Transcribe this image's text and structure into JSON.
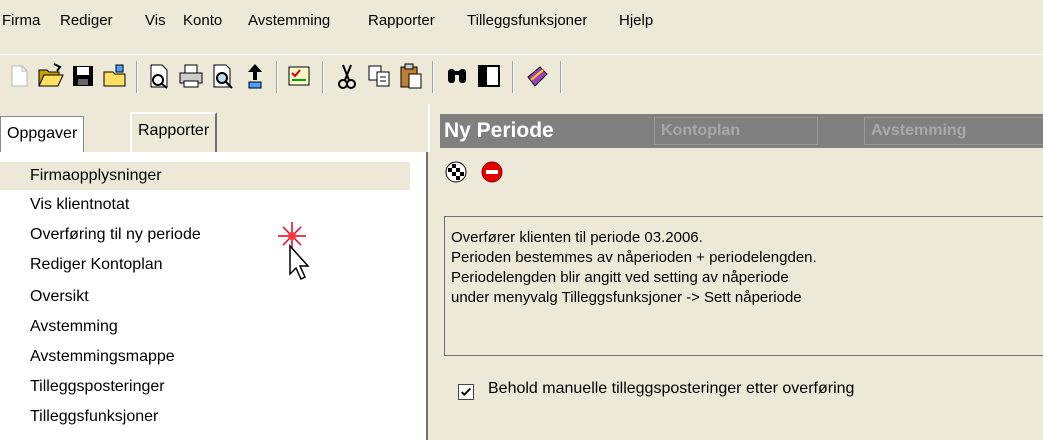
{
  "menu": [
    "Firma",
    "Rediger",
    "Vis",
    "Konto",
    "Avstemming",
    "Rapporter",
    "Tilleggsfunksjoner",
    "Hjelp"
  ],
  "toolbar": {
    "icons": [
      "new-document-icon",
      "open-folder-icon",
      "save-icon",
      "close-folder-icon",
      "preview-document-icon",
      "print-icon",
      "print-preview-icon",
      "export-icon",
      "checklist-icon",
      "cut-icon",
      "copy-icon",
      "paste-icon",
      "find-icon",
      "panel-icon",
      "help-book-icon"
    ]
  },
  "left_tabs": {
    "tasks": "Oppgaver",
    "reports": "Rapporter"
  },
  "tasks": [
    "Firmaopplysninger",
    "Vis klientnotat",
    "Overføring til ny periode",
    "Rediger Kontoplan",
    "Oversikt",
    "Avstemming",
    "Avstemmingsmappe",
    "Tilleggsposteringer",
    "Tilleggsfunksjoner"
  ],
  "selected_task_index": 0,
  "header": {
    "active": "Ny Periode",
    "tab2": "Kontoplan",
    "tab3": "Avstemming"
  },
  "actions": {
    "run_icon": "checkered-flag-icon",
    "cancel_icon": "stop-icon"
  },
  "info": {
    "lines": [
      "Overfører klienten til periode 03.2006.",
      "Perioden bestemmes av nåperioden + periodelengden.",
      "Periodelengden blir angitt ved setting av nåperiode",
      "under menyvalg Tilleggsfunksjoner -> Sett nåperiode"
    ]
  },
  "checkbox": {
    "label": "Behold manuelle tilleggsposteringer etter overføring",
    "checked": true
  }
}
